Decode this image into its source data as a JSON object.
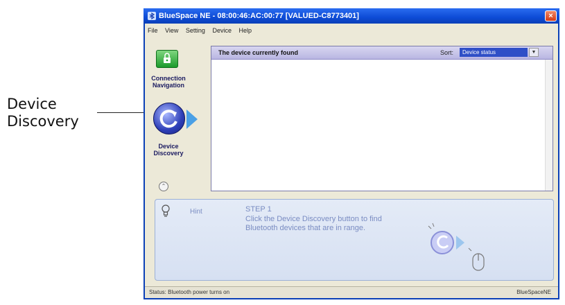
{
  "callout": {
    "label": "Device\nDiscovery"
  },
  "window": {
    "title": "BlueSpace NE - 08:00:46:AC:00:77 [VALUED-C8773401]",
    "close_label": "×"
  },
  "menu": [
    "File",
    "View",
    "Setting",
    "Device",
    "Help"
  ],
  "nav": {
    "connection_label": "Connection\nNavigation",
    "discovery_label": "Device\nDiscovery",
    "icons": {
      "connection": "lock-icon",
      "discovery": "refresh-icon",
      "collapse": "chevron-up-icon"
    }
  },
  "device_panel": {
    "title": "The device currently found",
    "sort_label": "Sort:",
    "sort_value": "Device status"
  },
  "hint": {
    "label": "Hint",
    "step": "STEP 1",
    "text": "Click the Device Discovery button to find Bluetooth devices that are in range."
  },
  "status": {
    "left": "Status: Bluetooth power turns on",
    "right": "BlueSpaceNE"
  },
  "colors": {
    "titlebar": "#0d4bd6",
    "accent": "#2e3fb8",
    "hint_text": "#7a8cc2"
  }
}
